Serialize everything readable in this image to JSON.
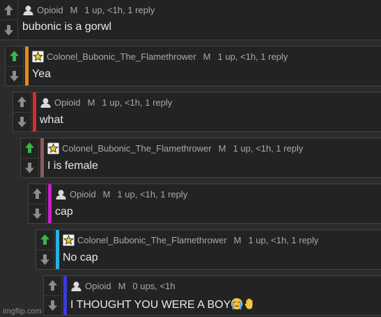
{
  "colors": {
    "upvote_active": "#39b54a",
    "arrow_inactive": "#8c8c8c"
  },
  "comments": [
    {
      "author": "Opioid",
      "badge": "user-icon",
      "mod": "M",
      "stats": "1 up, <1h, 1 reply",
      "text": "bubonic is a gorwl",
      "stripe": "",
      "upvoted": false
    },
    {
      "author": "Colonel_Bubonic_The_Flamethrower",
      "badge": "star-icon",
      "mod": "M",
      "stats": "1 up, <1h, 1 reply",
      "text": "Yea",
      "stripe": "#e58a17",
      "upvoted": true
    },
    {
      "author": "Opioid",
      "badge": "user-icon",
      "mod": "M",
      "stats": "1 up, <1h, 1 reply",
      "text": "what",
      "stripe": "#d62d2d",
      "upvoted": false
    },
    {
      "author": "Colonel_Bubonic_The_Flamethrower",
      "badge": "star-icon",
      "mod": "M",
      "stats": "1 up, <1h, 1 reply",
      "text": "I is female",
      "stripe": "#8a5c5c",
      "upvoted": true
    },
    {
      "author": "Opioid",
      "badge": "user-icon",
      "mod": "M",
      "stats": "1 up, <1h, 1 reply",
      "text": "cap",
      "stripe": "#c81fc8",
      "upvoted": false
    },
    {
      "author": "Colonel_Bubonic_The_Flamethrower",
      "badge": "star-icon",
      "mod": "M",
      "stats": "1 up, <1h, 1 reply",
      "text": "No cap",
      "stripe": "#22b3e6",
      "upvoted": true
    },
    {
      "author": "Opioid",
      "badge": "user-icon",
      "mod": "M",
      "stats": "0 ups, <1h",
      "text": "I THOUGHT YOU WERE A BOY",
      "stripe": "#3a3ae0",
      "upvoted": false,
      "emojis": [
        "crying-face-emoji",
        "raised-hand-emoji"
      ]
    }
  ],
  "watermark": "imgflip.com"
}
